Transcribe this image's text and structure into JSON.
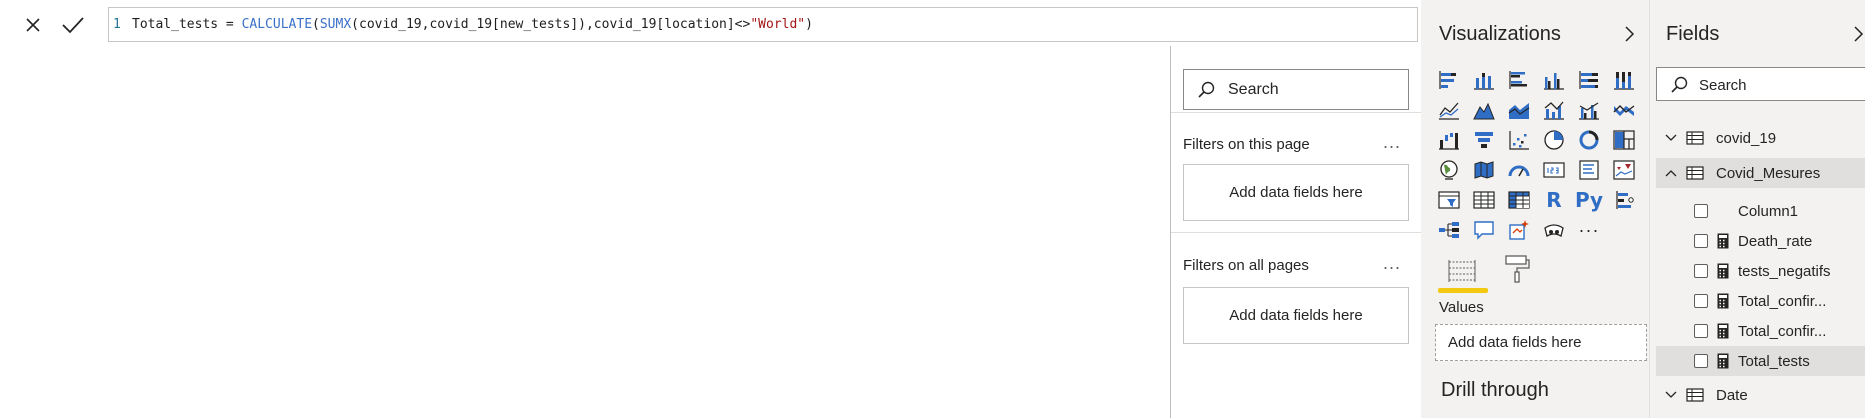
{
  "formula_bar": {
    "line_number": "1",
    "measure_name": "Total_tests = ",
    "fn_calculate": "CALCULATE",
    "paren_open": "(",
    "fn_sumx": "SUMX",
    "args": "(covid_19,covid_19[new_tests]),covid_19[location]<>",
    "string_literal": "\"World\"",
    "paren_close": ")"
  },
  "filters": {
    "search_placeholder": "Search",
    "sections": [
      {
        "title": "Filters on this page",
        "more": "...",
        "well": "Add data fields here"
      },
      {
        "title": "Filters on all pages",
        "more": "...",
        "well": "Add data fields here"
      }
    ]
  },
  "visualizations": {
    "title": "Visualizations",
    "more_visuals": "···",
    "r_visual": "R",
    "python_visual": "Py",
    "values_label": "Values",
    "values_well": "Add data fields here",
    "drill_through": "Drill through"
  },
  "fields": {
    "title": "Fields",
    "search_placeholder": "Search",
    "tables": [
      {
        "name": "covid_19",
        "expanded": false
      },
      {
        "name": "Covid_Mesures",
        "expanded": true
      },
      {
        "name": "Date",
        "expanded": false
      }
    ],
    "measures": [
      {
        "name": "Column1",
        "type": "column"
      },
      {
        "name": "Death_rate",
        "type": "measure"
      },
      {
        "name": "tests_negatifs",
        "type": "measure"
      },
      {
        "name": "Total_confir...",
        "type": "measure"
      },
      {
        "name": "Total_confir...",
        "type": "measure"
      },
      {
        "name": "Total_tests",
        "type": "measure",
        "selected": true
      }
    ]
  },
  "colors": {
    "accent_yellow": "#f2c811",
    "pane_bg": "#f3f2f1",
    "icon_blue": "#2f6ec4",
    "dax_function": "#3a70c8",
    "dax_string": "#a31515"
  }
}
